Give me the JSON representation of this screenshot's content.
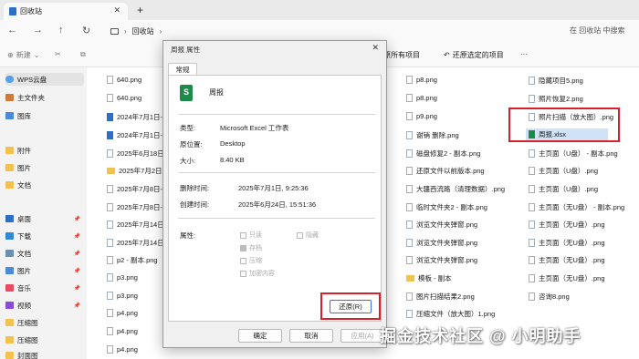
{
  "window": {
    "tab_title": "回收站",
    "tab_close": "✕",
    "tab_add": "+"
  },
  "navbar": {
    "path_root_icon": "monitor-icon",
    "path_segment": "回收站",
    "separator": "›",
    "search_placeholder": "在 回收站 中搜索"
  },
  "commandbar": {
    "new_label": "新建",
    "restore_all_label": "还原所有项目",
    "restore_selected_label": "还原选定的项目",
    "more_label": "···"
  },
  "sidebar": {
    "items": [
      {
        "label": "WPS云盘",
        "icon": "cloud-icon"
      },
      {
        "label": "主文件夹",
        "icon": "home-icon"
      },
      {
        "label": "图库",
        "icon": "gallery-icon"
      },
      {
        "label": "附件",
        "icon": "folder-icon"
      },
      {
        "label": "图片",
        "icon": "folder-icon"
      },
      {
        "label": "文档",
        "icon": "folder-icon"
      },
      {
        "label": "桌面",
        "icon": "desktop-icon"
      },
      {
        "label": "下载",
        "icon": "download-icon"
      },
      {
        "label": "文档",
        "icon": "documents-icon"
      },
      {
        "label": "图片",
        "icon": "pictures-icon"
      },
      {
        "label": "音乐",
        "icon": "music-icon"
      },
      {
        "label": "视频",
        "icon": "video-icon"
      },
      {
        "label": "压缩图",
        "icon": "folder-icon"
      },
      {
        "label": "压缩图",
        "icon": "folder-icon"
      },
      {
        "label": "封面图",
        "icon": "folder-icon"
      }
    ]
  },
  "files": {
    "col1": [
      "640.png",
      "640.png",
      "2024年7月1日-",
      "2024年7月1日-",
      "2025年6月18日",
      "2025年7月2日",
      "2025年7月8日-",
      "2025年7月8日-",
      "2025年7月14日",
      "2025年7月14日",
      "p2 - 副本.png",
      "p3.png",
      "p3.png",
      "p4.png",
      "p4.png",
      "p4.png"
    ],
    "col2": [
      "p8.png",
      "p8.png",
      "p9.png",
      "谢销 删除.png",
      "磁盘修复2 - 副本.png",
      "还原文件以前版本.png",
      "大疆西流路（清理数据）.png",
      "临时文件夹2 - 副本.png",
      "浏览文件夹弹窗.png",
      "浏览文件夹弹窗.png",
      "浏览文件夹弹窗.png",
      "模板 - 副本",
      "图片扫描结果2.png",
      "压缩文件（放大图）1.png",
      ""
    ],
    "col3": [
      "隐藏项目5.png",
      "照片恢复2.png",
      "照片扫描（放大图）.png",
      "周报.xlsx",
      "主页面（U盘） - 副本.png",
      "主页面（U盘）.png",
      "主页面（U盘）.png",
      "主页面（无U盘） - 副本.png",
      "主页面（无U盘）.png",
      "主页面（无U盘）.png",
      "主页面（无U盘）.png",
      "主页面（无U盘）.png",
      "咨询8.png",
      "",
      ""
    ]
  },
  "dialog": {
    "title": "周报 属性",
    "close": "✕",
    "tab_general": "常规",
    "file_name": "周报",
    "type_label": "类型:",
    "type_value": "Microsoft Excel 工作表",
    "location_label": "原位置:",
    "location_value": "Desktop",
    "size_label": "大小:",
    "size_value": "8.40 KB",
    "deleted_label": "删除时间:",
    "deleted_value": "2025年7月1日, 9:25:36",
    "created_label": "创建时间:",
    "created_value": "2025年6月24日, 15:51:36",
    "attributes_label": "属性:",
    "attr_readonly": "只读",
    "attr_hidden": "隐藏",
    "attr_archive": "存档",
    "attr_compress": "压缩",
    "attr_encrypt": "加密内容",
    "restore_button": "还原(R)",
    "ok_button": "确定",
    "cancel_button": "取消",
    "apply_button": "应用(A)"
  },
  "watermark": "掘金技术社区 @ 小明助手",
  "colors": {
    "highlight_red": "#d8202a",
    "excel_green": "#1e8a4a",
    "selection_blue": "#cfe3f7"
  }
}
